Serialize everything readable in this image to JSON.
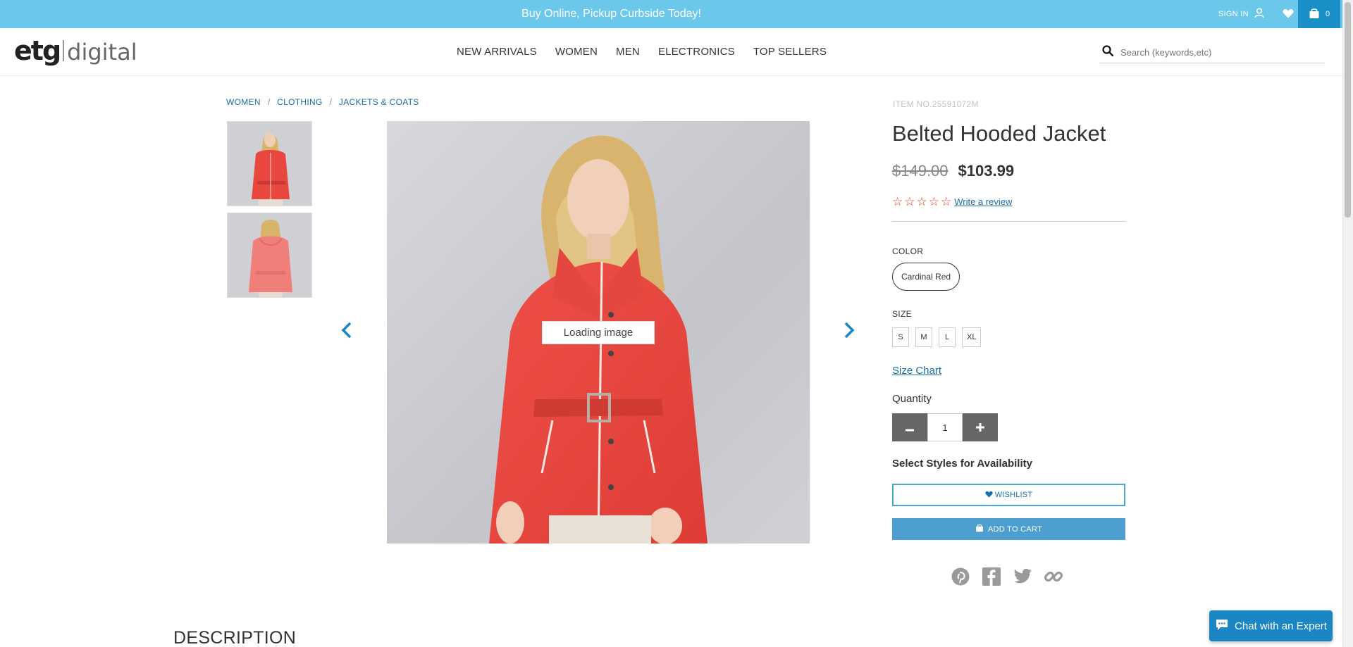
{
  "promo": {
    "text": "Buy Online, Pickup Curbside Today!"
  },
  "account": {
    "sign_in": "SIGN IN",
    "wishlist_count": "0",
    "cart_count": "0"
  },
  "logo": {
    "part1": "etg",
    "part2": "digital"
  },
  "nav": {
    "items": [
      "NEW ARRIVALS",
      "WOMEN",
      "MEN",
      "ELECTRONICS",
      "TOP SELLERS"
    ]
  },
  "search": {
    "placeholder": "Search (keywords,etc)"
  },
  "breadcrumb": {
    "items": [
      "WOMEN",
      "CLOTHING",
      "JACKETS & COATS"
    ],
    "separator": "/"
  },
  "gallery": {
    "loading_text": "Loading image"
  },
  "product": {
    "item_no": "ITEM NO.25591072M",
    "title": "Belted Hooded Jacket",
    "old_price": "$149.00",
    "new_price": "$103.99",
    "rating": 0,
    "rating_max": 5,
    "write_review": "Write a review",
    "color_label": "COLOR",
    "color_value": "Cardinal Red",
    "size_label": "SIZE",
    "sizes": [
      "S",
      "M",
      "L",
      "XL"
    ],
    "size_chart": "Size Chart",
    "quantity_label": "Quantity",
    "quantity": "1",
    "availability_text": "Select Styles for Availability",
    "wishlist_label": "WISHLIST",
    "add_to_cart_label": "ADD TO CART"
  },
  "section": {
    "description": "DESCRIPTION"
  },
  "chat": {
    "label": "Chat with an Expert"
  },
  "colors": {
    "promo_bar": "#6cc8ea",
    "link": "#1a6fa8",
    "jacket": "#e8463f",
    "star": "#e2401c",
    "cart_button": "#4d9fcf",
    "chat_button": "#1a86c4"
  },
  "icons": [
    "user-icon",
    "heart-icon",
    "cart-icon",
    "search-icon",
    "chevron-left-icon",
    "chevron-right-icon",
    "pinterest-icon",
    "facebook-icon",
    "twitter-icon",
    "link-icon",
    "chat-icon"
  ]
}
